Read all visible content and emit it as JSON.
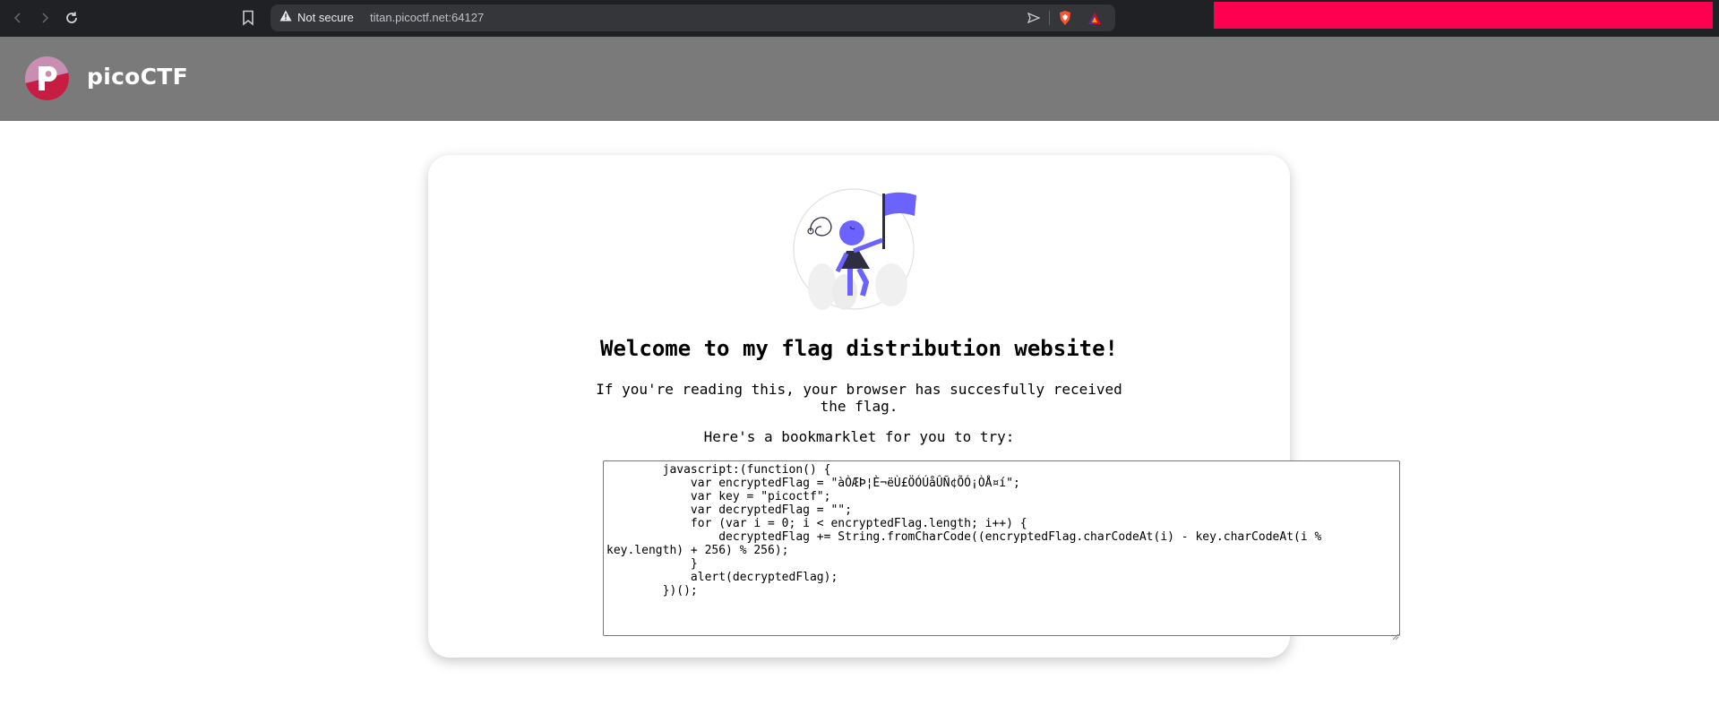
{
  "browser": {
    "security_label": "Not secure",
    "url": "titan.picoctf.net:64127"
  },
  "site": {
    "logo_text": "picoCTF",
    "logo_letter": "p"
  },
  "card": {
    "heading": "Welcome to my flag distribution website!",
    "paragraph": "If you're reading this, your browser has succesfully received the flag.",
    "bookmarklet_label": "Here's a bookmarklet for you to try:",
    "code": "        javascript:(function() {\n            var encryptedFlag = \"àÒÆÞ¦È¬ëÙ£ÖÓÚåÛÑ¢ÕÓ¡ÒÅ¤í\";\n            var key = \"picoctf\";\n            var decryptedFlag = \"\";\n            for (var i = 0; i < encryptedFlag.length; i++) {\n                decryptedFlag += String.fromCharCode((encryptedFlag.charCodeAt(i) - key.charCodeAt(i % key.length) + 256) % 256);\n            }\n            alert(decryptedFlag);\n        })();"
  },
  "colors": {
    "chrome_bg": "#202124",
    "header_bg": "#7a7a7a",
    "redaction": "#ff0051",
    "flag_purple": "#6c63ff"
  },
  "icons": [
    "back-arrow-icon",
    "forward-arrow-icon",
    "reload-icon",
    "bookmark-icon",
    "warning-icon",
    "send-icon",
    "brave-shield-icon",
    "brave-rewards-icon",
    "picoctf-logo-icon",
    "flag-person-illustration"
  ]
}
